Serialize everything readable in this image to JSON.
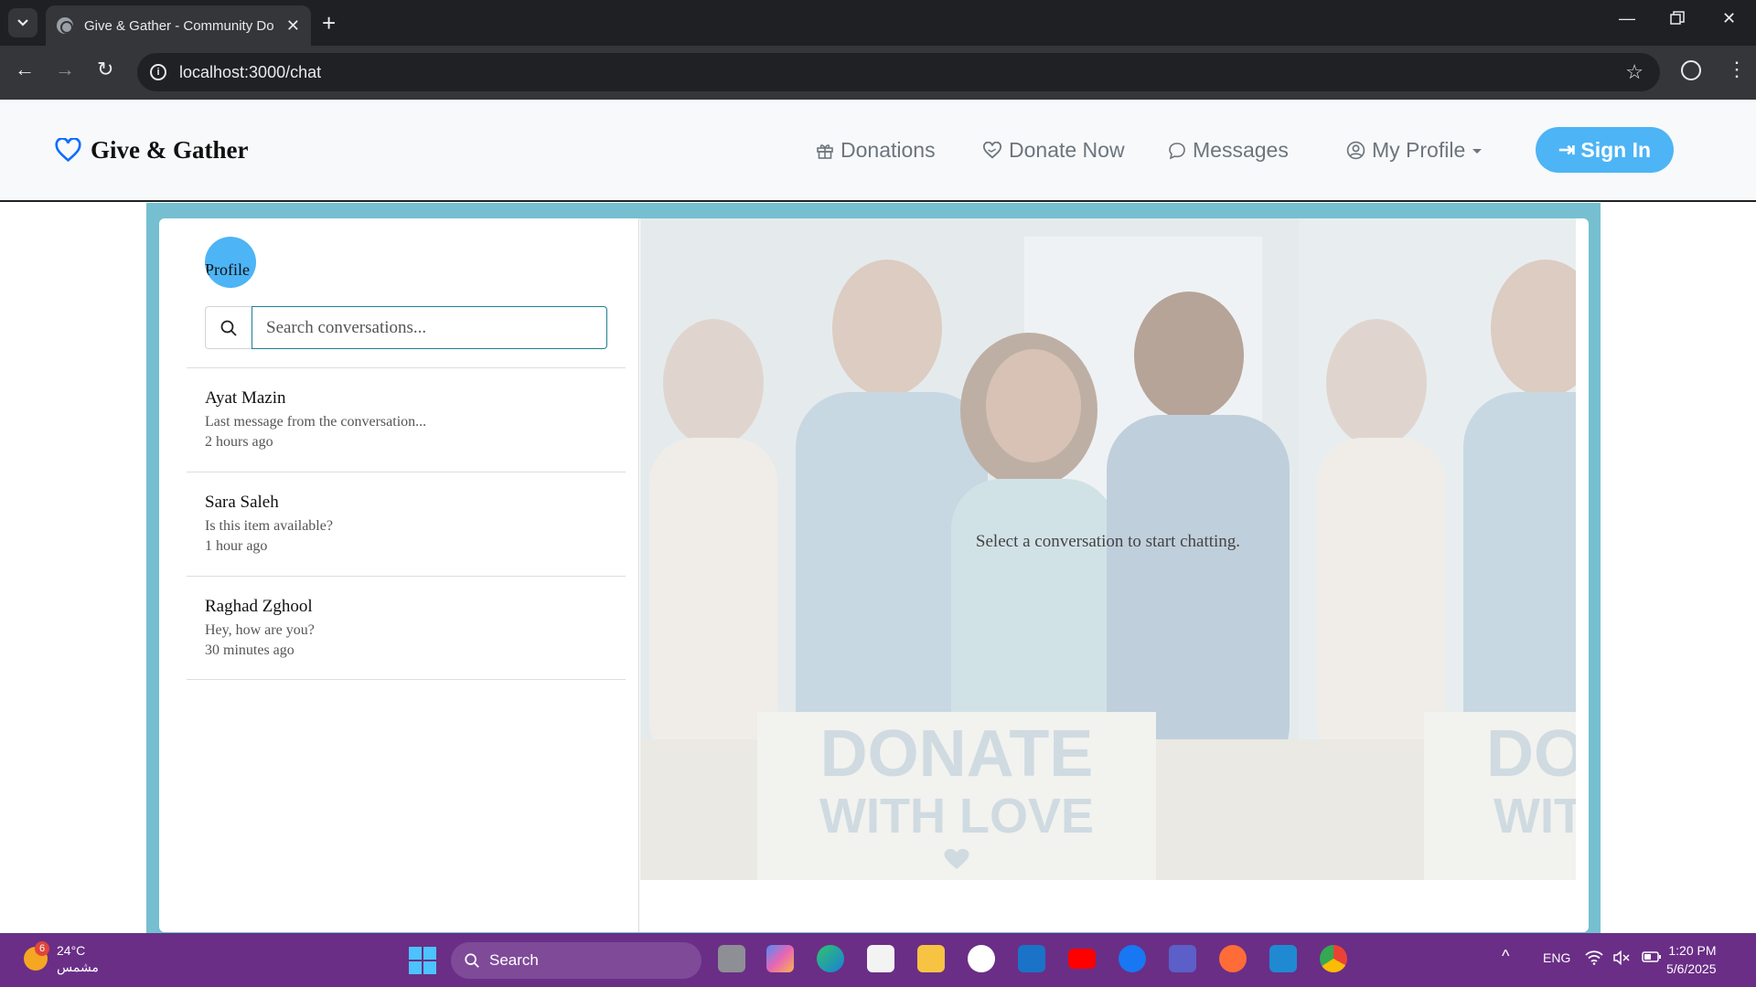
{
  "browser": {
    "tab_title": "Give & Gather - Community Do",
    "url": "localhost:3000/chat"
  },
  "navbar": {
    "brand": "Give & Gather",
    "links": {
      "donations": "Donations",
      "donate_now": "Donate Now",
      "messages": "Messages",
      "my_profile": "My Profile"
    },
    "sign_in": "Sign In"
  },
  "sidebar": {
    "avatar_alt": "Profile",
    "search_placeholder": "Search conversations...",
    "conversations": [
      {
        "name": "Ayat Mazin",
        "last_message": "Last message from the conversation...",
        "time": "2 hours ago"
      },
      {
        "name": "Sara Saleh",
        "last_message": "Is this item available?",
        "time": "1 hour ago"
      },
      {
        "name": "Raghad Zghool",
        "last_message": "Hey, how are you?",
        "time": "30 minutes ago"
      }
    ]
  },
  "main": {
    "empty_message": "Select a conversation to start chatting.",
    "banner_line1": "DONATE",
    "banner_line2": "WITH LOVE",
    "banner_repeat_line1": "DO",
    "banner_repeat_line2": "WIT"
  },
  "taskbar": {
    "weather_temp": "24°C",
    "weather_desc": "مشمس",
    "weather_badge": "6",
    "search_label": "Search",
    "language": "ENG",
    "time": "1:20 PM",
    "date": "5/6/2025"
  }
}
